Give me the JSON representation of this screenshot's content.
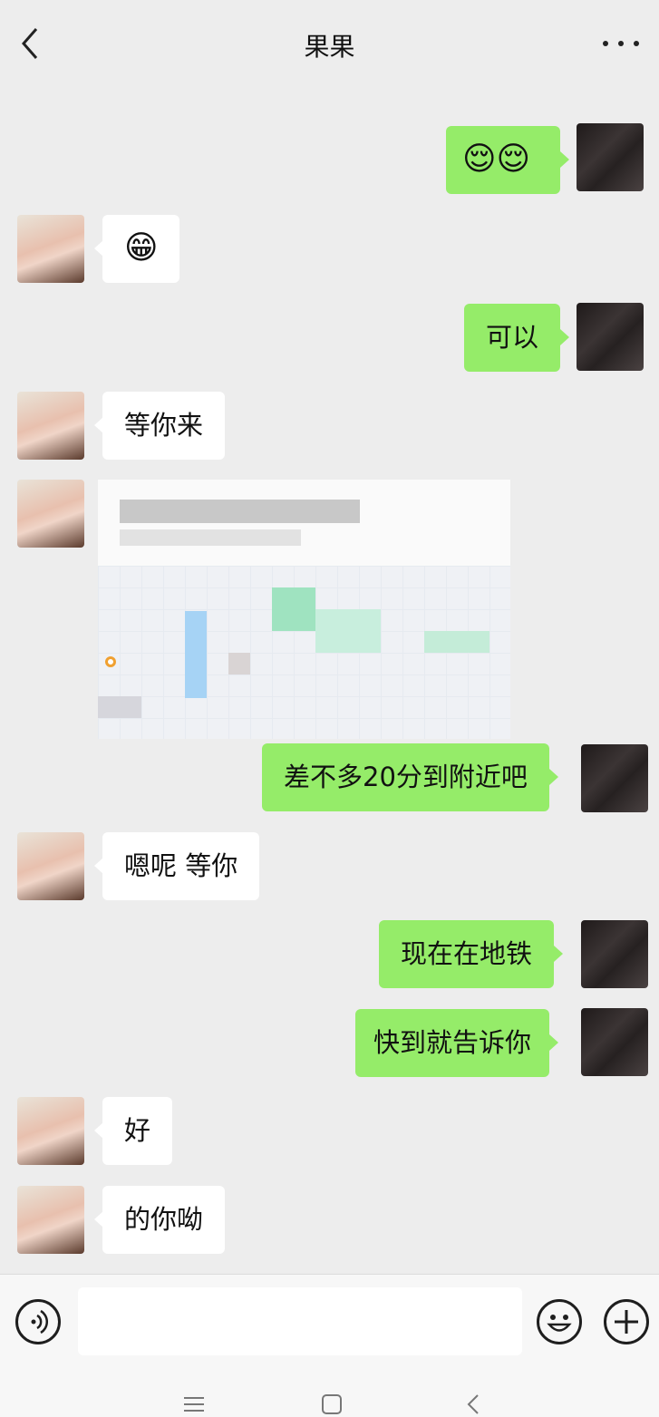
{
  "header": {
    "title": "果果"
  },
  "messages": [
    {
      "side": "self",
      "type": "emoji",
      "text": "😌😌"
    },
    {
      "side": "friend",
      "type": "emoji",
      "text": "😁"
    },
    {
      "side": "self",
      "type": "text",
      "text": "可以"
    },
    {
      "side": "friend",
      "type": "text",
      "text": "等你来"
    },
    {
      "side": "friend",
      "type": "location"
    },
    {
      "side": "self",
      "type": "text",
      "text": "差不多20分到附近吧"
    },
    {
      "side": "friend",
      "type": "text",
      "text": "嗯呢 等你"
    },
    {
      "side": "self",
      "type": "text",
      "text": "现在在地铁"
    },
    {
      "side": "self",
      "type": "text",
      "text": "快到就告诉你"
    },
    {
      "side": "friend",
      "type": "text",
      "text": "好"
    },
    {
      "side": "friend",
      "type": "text",
      "text": "的你呦"
    }
  ],
  "input": {
    "value": ""
  },
  "icons": [
    "back-icon",
    "more-icon",
    "voice-icon",
    "emoji-icon",
    "plus-icon",
    "menu-nav-icon",
    "home-nav-icon",
    "back-nav-icon"
  ],
  "colors": {
    "self_bubble": "#95ec69",
    "friend_bubble": "#ffffff",
    "background": "#ededed"
  }
}
